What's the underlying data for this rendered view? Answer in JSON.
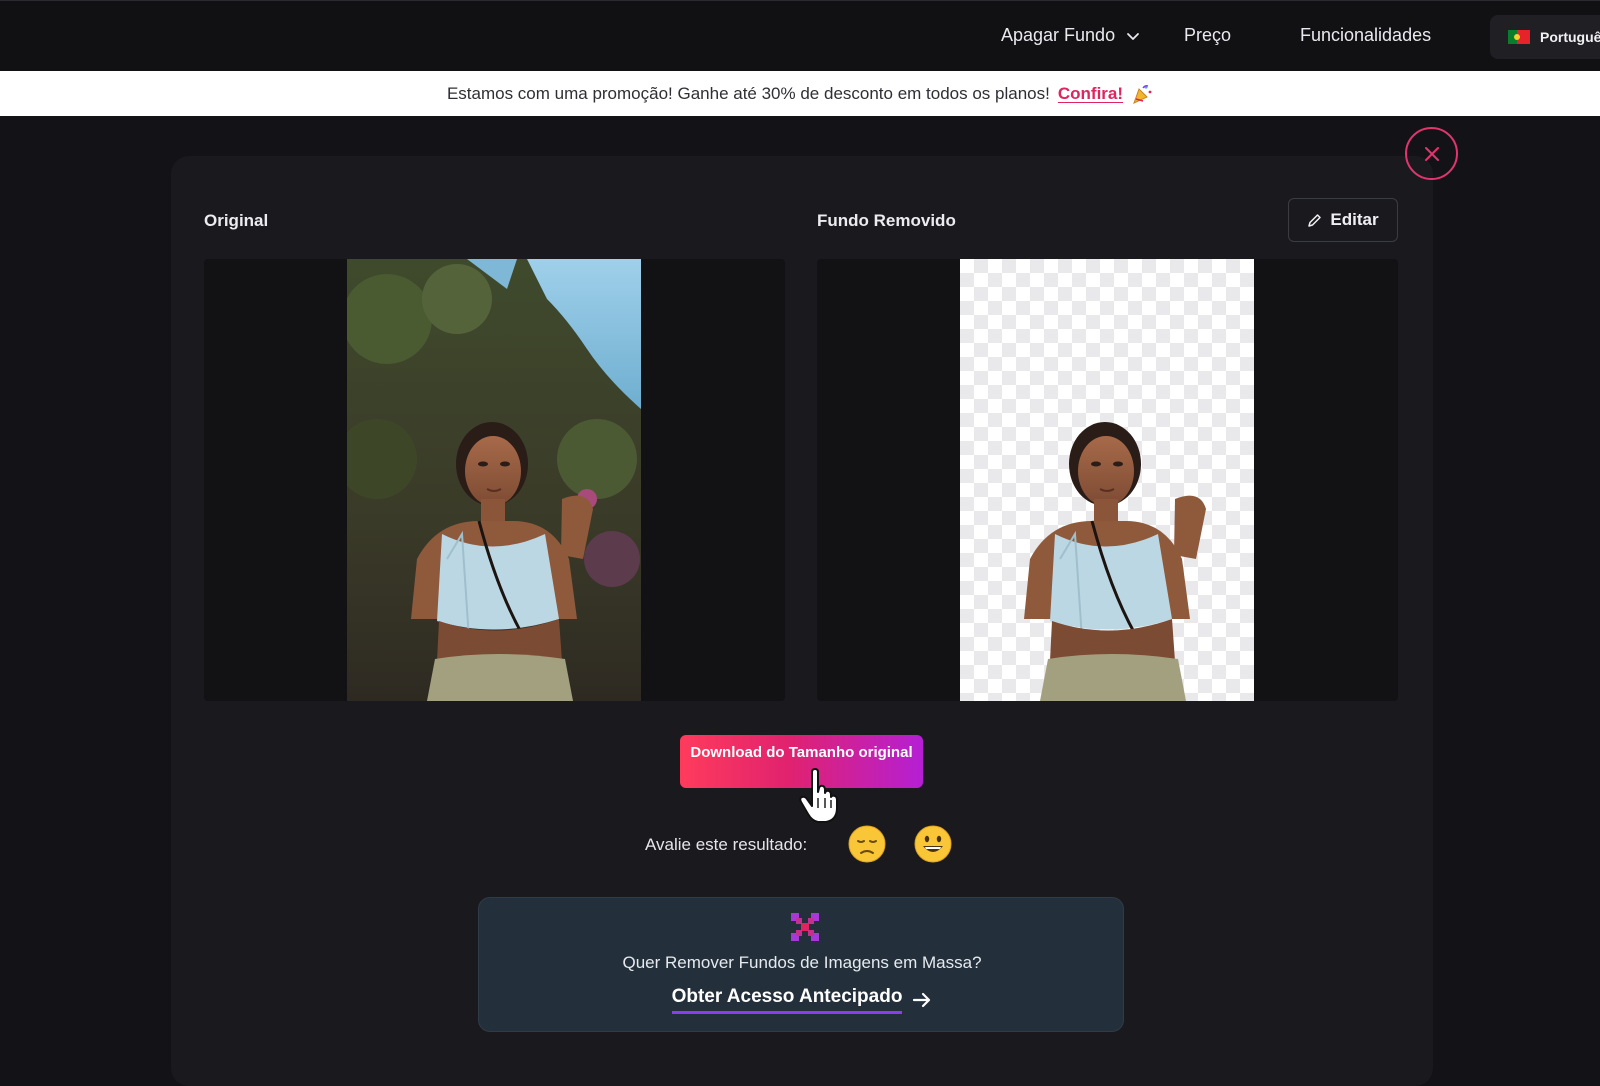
{
  "nav": {
    "items": [
      {
        "label": "Apagar Fundo"
      },
      {
        "label": "Preço"
      },
      {
        "label": "Funcionalidades"
      }
    ],
    "language": "Portuguê"
  },
  "promo": {
    "text": "Estamos com uma promoção! Ganhe até 30% de desconto em todos os planos!",
    "link": "Confira!"
  },
  "result": {
    "original_title": "Original",
    "removed_title": "Fundo Removido",
    "edit_label": "Editar",
    "download_label": "Download do Tamanho original"
  },
  "rating": {
    "label": "Avalie este resultado:"
  },
  "bulk": {
    "text": "Quer Remover Fundos de Imagens em Massa?",
    "cta": "Obter Acesso Antecipado"
  },
  "colors": {
    "accent_pink": "#e0245e",
    "download_gradient_start": "#ff3b5c",
    "download_gradient_end": "#b51fd4",
    "bulk_card_bg": "#23303b"
  }
}
